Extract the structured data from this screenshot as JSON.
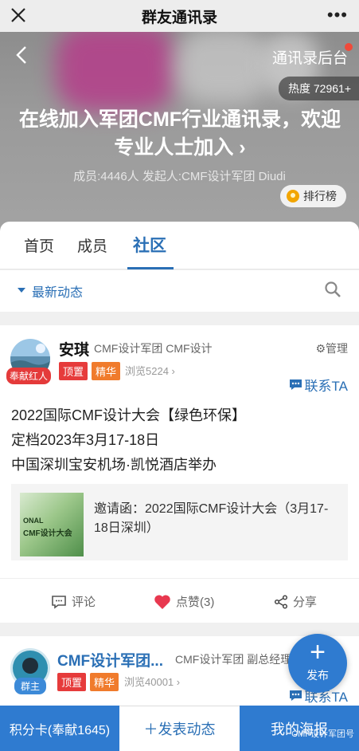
{
  "topbar": {
    "title": "群友通讯录",
    "more": "•••"
  },
  "hero": {
    "admin_link": "通讯录后台",
    "heat": "热度 72961+",
    "title": "在线加入军团CMF行业通讯录，欢迎专业人士加入 ›",
    "subtitle": "成员:4446人  发起人:CMF设计军团 Diudi",
    "rank_label": "排行榜"
  },
  "tabs": [
    {
      "label": "首页"
    },
    {
      "label": "成员"
    },
    {
      "label": "社区"
    }
  ],
  "filter": {
    "label": "最新动态"
  },
  "post1": {
    "name": "安琪",
    "group": "CMF设计军团 CMF设计",
    "badge": "奉献红人",
    "tag_top": "顶置",
    "tag_essence": "精华",
    "views": "浏览5224 ›",
    "manage": "管理",
    "contact": "联系TA",
    "content": [
      "2022国际CMF设计大会【绿色环保】",
      "定档2023年3月17-18日",
      "中国深圳宝安机场·凯悦酒店举办"
    ],
    "link_text": "邀请函：2022国际CMF设计大会（3月17-18日深圳）",
    "thumb_line1": "ONAL",
    "thumb_line2": "CMF设计大会",
    "comment": "评论",
    "like": "点赞(3)",
    "share": "分享"
  },
  "post2": {
    "name": "CMF设计军团...",
    "group": "CMF设计军团 副总经理",
    "badge": "群主",
    "tag_top": "顶置",
    "tag_essence": "精华",
    "views": "浏览40001 ›",
    "contact": "联系TA"
  },
  "fab": {
    "label": "发布"
  },
  "bottombar": {
    "points": "积分卡(奉献1645)",
    "post": "＋发表动态",
    "poster": "我的海报",
    "watermark": "CMF设计军团号"
  },
  "colors": {
    "accent": "#2f7bd0",
    "top_tag": "#e63b3b",
    "essence_tag": "#f07b2c",
    "badge_red": "#e43a3a"
  }
}
